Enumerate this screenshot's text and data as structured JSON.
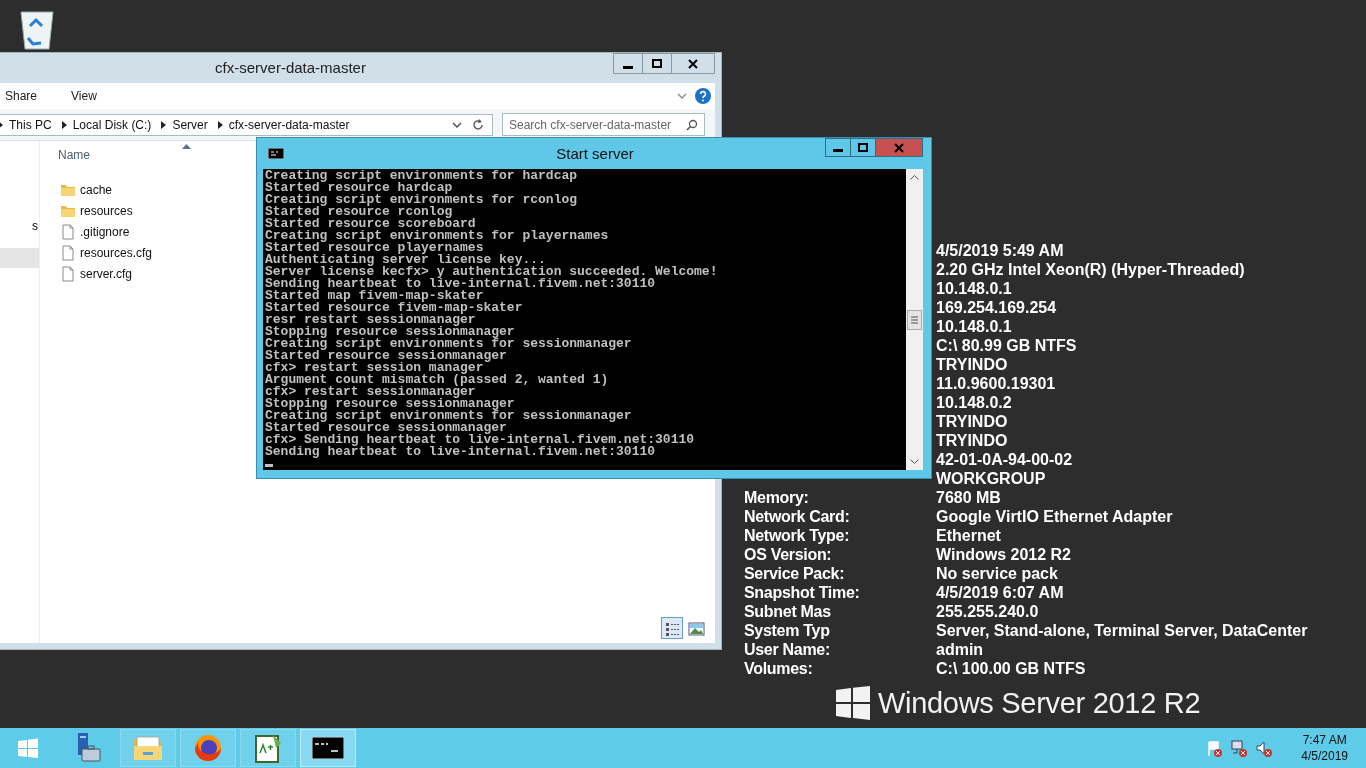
{
  "explorer": {
    "title": "cfx-server-data-master",
    "ribbon_tabs": [
      "Share",
      "View"
    ],
    "breadcrumb": [
      "This PC",
      "Local Disk (C:)",
      "Server",
      "cfx-server-data-master"
    ],
    "search": {
      "placeholder": "Search cfx-server-data-master"
    },
    "nav_items": [
      {
        "label": "s",
        "selected": false
      },
      {
        "selected": true
      }
    ],
    "columns": [
      {
        "label": "Name",
        "sorted": true
      }
    ],
    "files": [
      {
        "name": "cache",
        "kind": "folder"
      },
      {
        "name": "resources",
        "kind": "folder"
      },
      {
        "name": ".gitignore",
        "kind": "file"
      },
      {
        "name": "resources.cfg",
        "kind": "file"
      },
      {
        "name": "server.cfg",
        "kind": "file"
      }
    ],
    "view_buttons": [
      {
        "kind": "details",
        "selected": true
      },
      {
        "kind": "large-icons",
        "selected": false
      }
    ]
  },
  "bginfo": [
    {
      "value": "4/5/2019 5:49 AM"
    },
    {
      "value": "2.20 GHz Intel Xeon(R) (Hyper-Threaded)"
    },
    {
      "value": "10.148.0.1"
    },
    {
      "value": "169.254.169.254"
    },
    {
      "value": "10.148.0.1"
    },
    {
      "value": "C:\\ 80.99 GB NTFS"
    },
    {
      "value": "TRYINDO"
    },
    {
      "value": "11.0.9600.19301"
    },
    {
      "value": "10.148.0.2"
    },
    {
      "value": "TRYINDO"
    },
    {
      "value": "TRYINDO"
    },
    {
      "value": "42-01-0A-94-00-02"
    },
    {
      "value": "WORKGROUP"
    },
    {
      "label": "Memory:",
      "value": "7680 MB"
    },
    {
      "label": "Network Card:",
      "value": "Google VirtIO Ethernet Adapter"
    },
    {
      "label": "Network Type:",
      "value": "Ethernet"
    },
    {
      "label": "OS Version:",
      "value": "Windows 2012 R2"
    },
    {
      "label": "Service Pack:",
      "value": "No service pack"
    },
    {
      "label": "Snapshot Time:",
      "value": "4/5/2019 6:07 AM"
    },
    {
      "label": "Subnet Mas",
      "value": "255.255.240.0"
    },
    {
      "label": "System Typ",
      "value": "Server, Stand-alone, Terminal Server, DataCenter"
    },
    {
      "label": "User Name:",
      "value": "admin"
    },
    {
      "label": "Volumes:",
      "value": "C:\\ 100.00 GB NTFS"
    }
  ],
  "branding": "Windows Server 2012 R2",
  "console": {
    "title": "Start server",
    "lines": [
      "Creating script environments for hardcap",
      "Started resource hardcap",
      "Creating script environments for rconlog",
      "Started resource rconlog",
      "Started resource scoreboard",
      "Creating script environments for playernames",
      "Started resource playernames",
      "Authenticating server license key...",
      "Server license kecfx> y authentication succeeded. Welcome!",
      "Sending heartbeat to live-internal.fivem.net:30110",
      "Started map fivem-map-skater",
      "Started resource fivem-map-skater",
      "resr restart sessionmanager",
      "Stopping resource sessionmanager",
      "Creating script environments for sessionmanager",
      "Started resource sessionmanager",
      "cfx> restart session manager",
      "Argument count mismatch (passed 2, wanted 1)",
      "cfx> restart sessionmanager",
      "Stopping resource sessionmanager",
      "Creating script environments for sessionmanager",
      "Started resource sessionmanager",
      "cfx> Sending heartbeat to live-internal.fivem.net:30110",
      "Sending heartbeat to live-internal.fivem.net:30110"
    ]
  },
  "taskbar": {
    "items": [
      {
        "kind": "start",
        "selected": false
      },
      {
        "kind": "server-manager",
        "selected": false
      },
      {
        "kind": "explorer",
        "selected": false
      },
      {
        "kind": "firefox",
        "selected": false
      },
      {
        "kind": "notepad",
        "selected": false
      },
      {
        "kind": "console",
        "selected": true
      }
    ],
    "tray": [
      {
        "kind": "flag"
      },
      {
        "kind": "network"
      },
      {
        "kind": "speaker"
      }
    ],
    "time": "7:47 AM",
    "date": "4/5/2019"
  }
}
